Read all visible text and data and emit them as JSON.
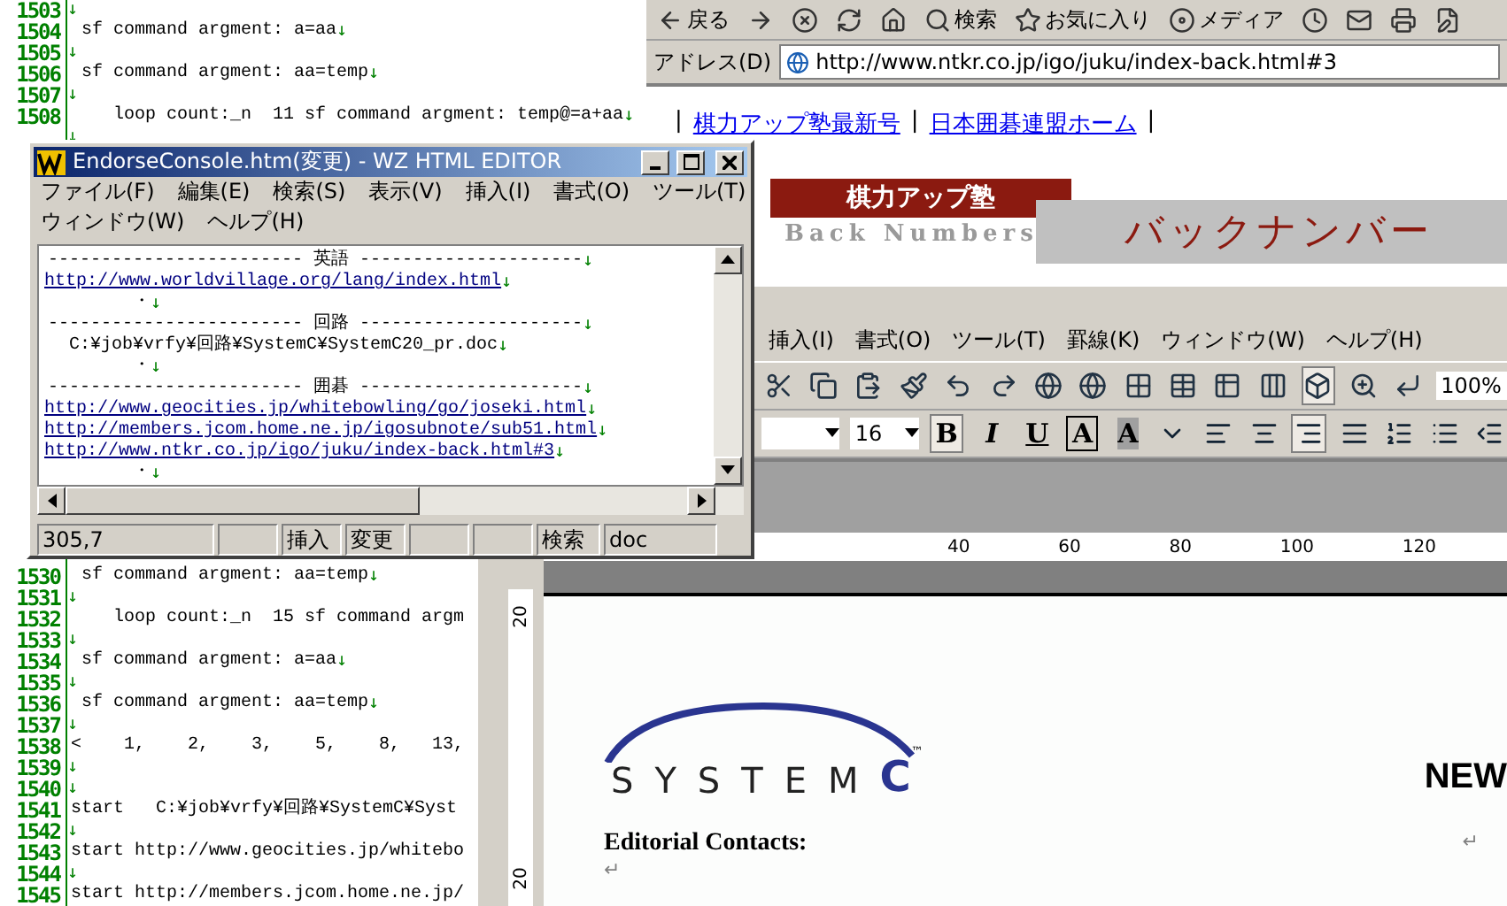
{
  "eol_mark": "↓",
  "editor": {
    "upper_lines": [
      {
        "number": "1503",
        "eol": true
      },
      {
        "number": "1504",
        "text": " sf command argment: a=aa",
        "eol": true
      },
      {
        "number": "1505",
        "eol": true
      },
      {
        "number": "1506",
        "text": " sf command argment: aa=temp",
        "eol": true
      },
      {
        "number": "1507",
        "eol": true
      },
      {
        "number": "1508",
        "text": "    loop count:_n  11 sf command argment: temp@=a+aa",
        "eol": true
      },
      {
        "eol": true
      }
    ],
    "lower_lines": [
      {
        "number": "1530",
        "text": " sf command argment: aa=temp",
        "eol": true
      },
      {
        "number": "1531",
        "eol": true
      },
      {
        "number": "1532",
        "text": "    loop count:_n  15 sf command argm",
        "eol": false
      },
      {
        "number": "1533",
        "eol": true
      },
      {
        "number": "1534",
        "text": " sf command argment: a=aa",
        "eol": true
      },
      {
        "number": "1535",
        "eol": true
      },
      {
        "number": "1536",
        "text": " sf command argment: aa=temp",
        "eol": true
      },
      {
        "number": "1537",
        "eol": true
      },
      {
        "number": "1538",
        "text": "<    1,    2,    3,    5,    8,   13,",
        "eol": false
      },
      {
        "number": "1539",
        "eol": true
      },
      {
        "number": "1540",
        "eol": true
      },
      {
        "number": "1541",
        "text": "start   C:¥job¥vrfy¥回路¥SystemC¥Syst",
        "eol": false
      },
      {
        "number": "1542",
        "eol": true
      },
      {
        "number": "1543",
        "text": "start http://www.geocities.jp/whitebo",
        "eol": false
      },
      {
        "number": "1544",
        "eol": true
      },
      {
        "number": "1545",
        "text": "start http://members.jcom.home.ne.jp/",
        "eol": false
      }
    ]
  },
  "browser": {
    "toolbar": [
      {
        "kind": "back",
        "label": "戻る"
      },
      {
        "kind": "forward"
      },
      {
        "kind": "stop"
      },
      {
        "kind": "refresh"
      },
      {
        "kind": "home"
      },
      {
        "kind": "search",
        "label": "検索"
      },
      {
        "kind": "favorites",
        "label": "お気に入り"
      },
      {
        "kind": "media",
        "label": "メディア"
      },
      {
        "kind": "history"
      },
      {
        "kind": "mail"
      },
      {
        "kind": "print"
      },
      {
        "kind": "edit"
      }
    ],
    "address_label": "アドレス(D)",
    "url": "http://www.ntkr.co.jp/igo/juku/index-back.html#3",
    "nav": {
      "separator": "|",
      "links": [
        "棋力アップ塾最新号",
        "日本囲碁連盟ホーム"
      ]
    },
    "banner": {
      "title": "棋力アップ塾",
      "subtitle": "Back Numbers",
      "heading": "バックナンバー"
    }
  },
  "word": {
    "menu": [
      "挿入(I)",
      "書式(O)",
      "ツール(T)",
      "罫線(K)",
      "ウィンドウ(W)",
      "ヘルプ(H)"
    ],
    "standard_toolbar": [
      {
        "kind": "cut",
        "pressed": false
      },
      {
        "kind": "copy",
        "pressed": false
      },
      {
        "kind": "paste",
        "pressed": false
      },
      {
        "kind": "brush",
        "pressed": false
      },
      {
        "kind": "undo",
        "pressed": false
      },
      {
        "kind": "redo",
        "pressed": false
      },
      {
        "kind": "globe-link",
        "pressed": false
      },
      {
        "kind": "globe-arrows",
        "pressed": false
      },
      {
        "kind": "table-draw",
        "pressed": false
      },
      {
        "kind": "table",
        "pressed": false
      },
      {
        "kind": "table-edit",
        "pressed": false
      },
      {
        "kind": "columns",
        "pressed": false
      },
      {
        "kind": "drawing",
        "pressed": true
      },
      {
        "kind": "preview",
        "pressed": false
      },
      {
        "kind": "return",
        "pressed": false
      }
    ],
    "zoom": "100%",
    "font_size": "16",
    "format_toolbar": [
      {
        "kind": "bold",
        "label": "B",
        "pressed": true
      },
      {
        "kind": "italic",
        "label": "I",
        "pressed": false
      },
      {
        "kind": "underline",
        "label": "U",
        "pressed": false
      },
      {
        "kind": "boxed",
        "label": "A",
        "pressed": false
      },
      {
        "kind": "shaded",
        "label": "A",
        "pressed": false
      },
      {
        "kind": "ruby",
        "pressed": false
      },
      {
        "kind": "align-left",
        "pressed": false
      },
      {
        "kind": "align-center",
        "pressed": false
      },
      {
        "kind": "align-right",
        "pressed": true
      },
      {
        "kind": "justify",
        "pressed": false
      },
      {
        "kind": "numbered-list",
        "pressed": false
      },
      {
        "kind": "bullet-list",
        "pressed": false
      },
      {
        "kind": "outdent",
        "pressed": false
      }
    ],
    "ruler": [
      "40",
      "60",
      "80",
      "100",
      "120"
    ],
    "vertical_ruler": [
      "20",
      "20"
    ],
    "document": {
      "logo": {
        "word": "SYSTEM",
        "letter": "C",
        "mark": "™"
      },
      "heading": "NEW",
      "contacts": "Editorial Contacts:",
      "para_mark": "↵"
    }
  },
  "wz": {
    "title": "EndorseConsole.htm(変更) - WZ HTML EDITOR",
    "menu": [
      [
        "ファイル(F)",
        "編集(E)",
        "検索(S)",
        "表示(V)",
        "挿入(I)",
        "書式(O)",
        "ツール(T)"
      ],
      [
        "ウィンドウ(W)",
        "ヘルプ(H)"
      ]
    ],
    "lines": [
      {
        "kind": "rule",
        "text": "------------------------ 英語 ---------------------",
        "eol": true
      },
      {
        "kind": "link",
        "text": "http://www.worldvillage.org/lang/index.html",
        "eol": true
      },
      {
        "kind": "plain",
        "text": "        ・",
        "eol": true
      },
      {
        "kind": "rule",
        "text": "------------------------ 回路 ---------------------",
        "eol": true
      },
      {
        "kind": "plain",
        "text": "  C:¥job¥vrfy¥回路¥SystemC¥SystemC20_pr.doc",
        "eol": true
      },
      {
        "kind": "plain",
        "text": "        ・",
        "eol": true
      },
      {
        "kind": "rule",
        "text": "------------------------ 囲碁 ---------------------",
        "eol": true
      },
      {
        "kind": "link",
        "text": "http://www.geocities.jp/whitebowling/go/joseki.html",
        "eol": true
      },
      {
        "kind": "link",
        "text": "http://members.jcom.home.ne.jp/igosubnote/sub51.html",
        "eol": true
      },
      {
        "kind": "link",
        "text": "http://www.ntkr.co.jp/igo/juku/index-back.html#3",
        "eol": true
      },
      {
        "kind": "plain",
        "text": "        ・",
        "eol": true
      }
    ],
    "status": [
      {
        "kind": "text",
        "text": "305,7"
      },
      {
        "kind": "blank"
      },
      {
        "kind": "text",
        "text": "挿入"
      },
      {
        "kind": "text",
        "text": "変更"
      },
      {
        "kind": "blank"
      },
      {
        "kind": "blank"
      },
      {
        "kind": "text",
        "text": "検索"
      },
      {
        "kind": "text",
        "text": "doc"
      }
    ]
  }
}
